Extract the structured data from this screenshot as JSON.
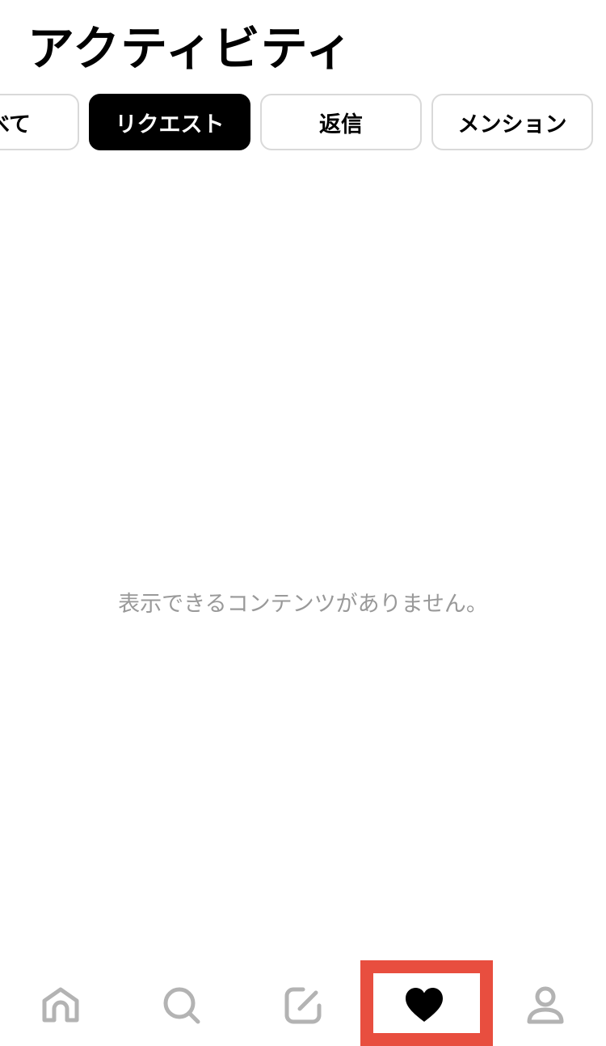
{
  "header": {
    "title": "アクティビティ"
  },
  "tabs": [
    {
      "label": "すべて",
      "active": false
    },
    {
      "label": "リクエスト",
      "active": true
    },
    {
      "label": "返信",
      "active": false
    },
    {
      "label": "メンション",
      "active": false
    }
  ],
  "content": {
    "empty_message": "表示できるコンテンツがありません。"
  },
  "bottom_nav": {
    "items": [
      {
        "icon": "home-icon",
        "active": false
      },
      {
        "icon": "search-icon",
        "active": false
      },
      {
        "icon": "compose-icon",
        "active": false
      },
      {
        "icon": "heart-icon",
        "active": true
      },
      {
        "icon": "profile-icon",
        "active": false
      }
    ]
  },
  "colors": {
    "active_tab_bg": "#000000",
    "tab_border": "#d9d9d9",
    "icon_inactive": "#b3b3b3",
    "icon_active": "#000000",
    "muted_text": "#999999",
    "highlight": "#e84e3f"
  }
}
